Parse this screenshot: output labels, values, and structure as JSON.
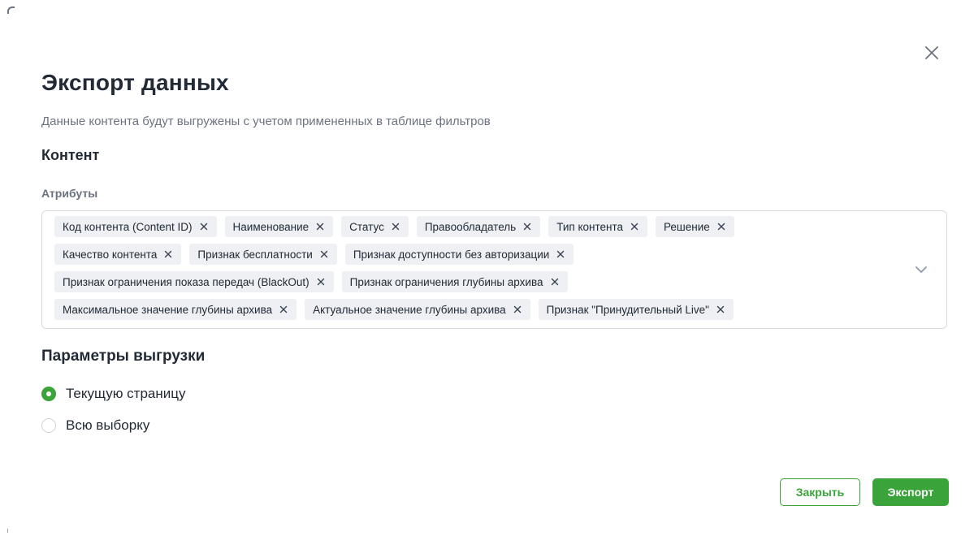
{
  "dialog": {
    "title": "Экспорт данных",
    "subtitle": "Данные контента будут выгружены с учетом примененных в таблице фильтров"
  },
  "content_section": {
    "title": "Контент",
    "attributes_label": "Атрибуты",
    "tags": [
      [
        "Код контента (Content ID)",
        "Наименование",
        "Статус",
        "Правообладатель",
        "Тип контента",
        "Решение"
      ],
      [
        "Качество контента",
        "Признак бесплатности",
        "Признак доступности без авторизации"
      ],
      [
        "Признак ограничения показа передач (BlackOut)",
        "Признак ограничения глубины архива"
      ],
      [
        "Максимальное значение глубины архива",
        "Актуальное значение глубины архива",
        "Признак \"Принудительный Live\""
      ]
    ]
  },
  "export_params": {
    "title": "Параметры выгрузки",
    "options": [
      {
        "label": "Текущую страницу",
        "selected": true
      },
      {
        "label": "Всю выборку",
        "selected": false
      }
    ]
  },
  "buttons": {
    "close_label": "Закрыть",
    "export_label": "Экспорт"
  },
  "colors": {
    "accent": "#3aa339",
    "tag_bg": "#eef0f3",
    "border": "#d7dbe0"
  },
  "icons": {
    "close": "close-icon",
    "chevron": "chevron-down-icon",
    "tag_remove": "remove-tag-icon"
  }
}
